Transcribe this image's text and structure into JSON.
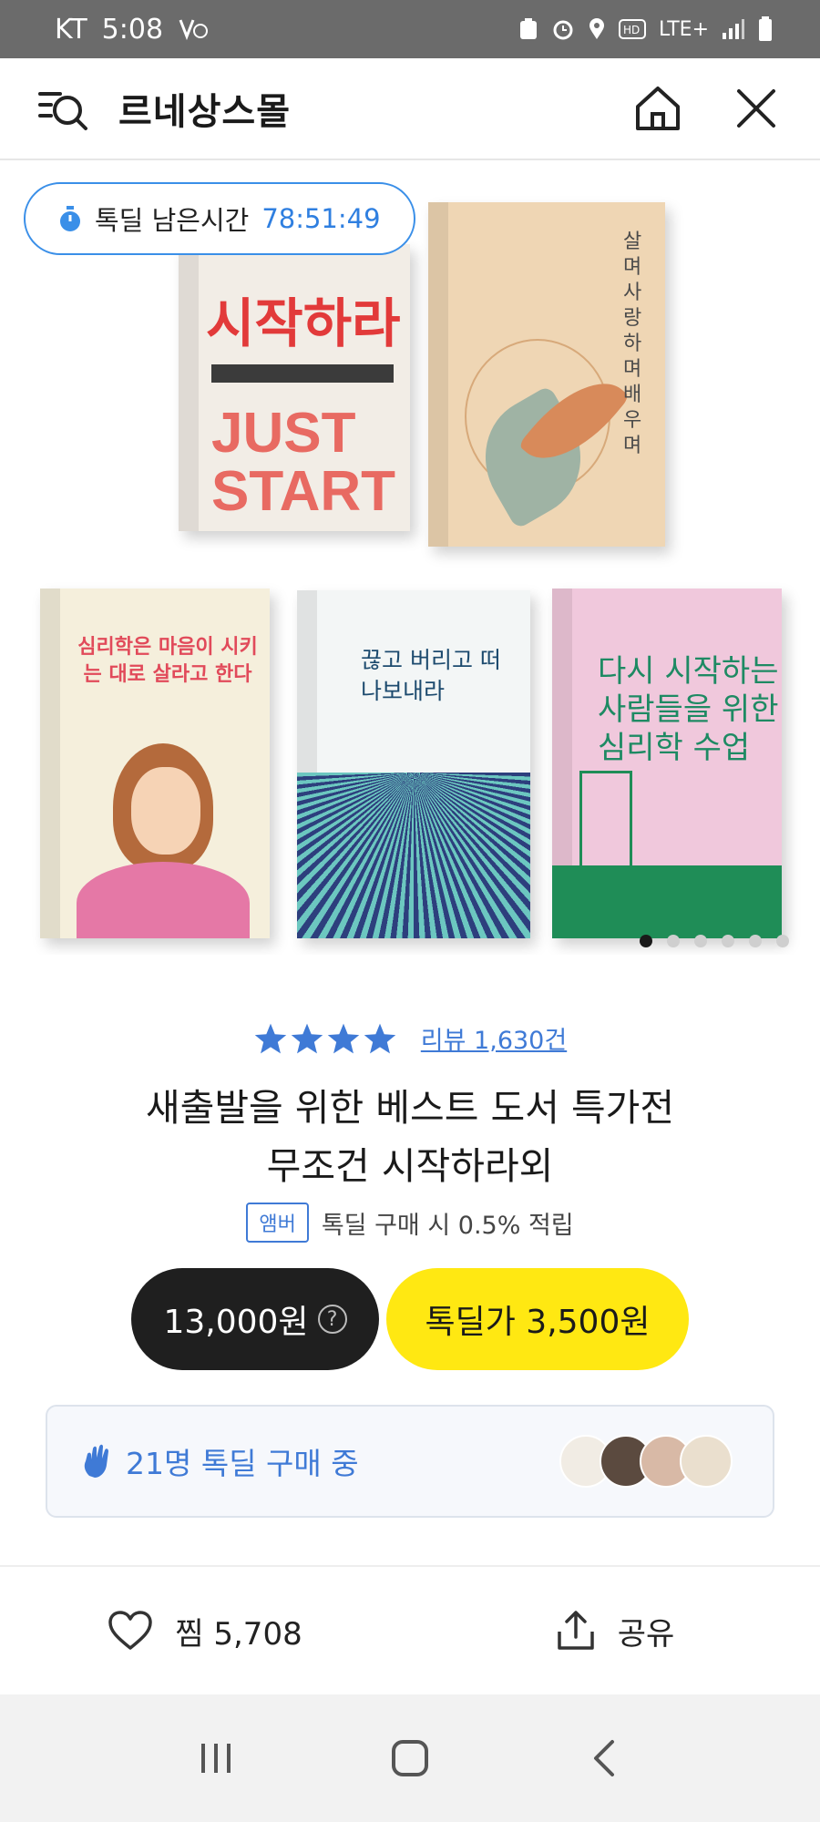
{
  "status_bar": {
    "carrier": "KT",
    "time": "5:08",
    "network": "LTE+"
  },
  "header": {
    "title": "르네상스몰"
  },
  "carousel": {
    "timer_label": "톡딜 남은시간",
    "timer_value": "78:51:49",
    "slide_count": 6,
    "active_slide": 1,
    "books": [
      {
        "cover_text": "시작하라"
      },
      {
        "cover_text": "살며 사랑하며 배우며"
      },
      {
        "cover_text": "심리학은 마음이 시키는 대로 살라고 한다"
      },
      {
        "cover_text": "끊고 버리고 떠나보내라"
      },
      {
        "cover_text": "다시 시작하는 사람들을 위한 심리학 수업"
      }
    ],
    "b1_extra": "JUST START"
  },
  "product": {
    "rating_stars": 4,
    "review_link": "리뷰 1,630건",
    "title_line1": "새출발을 위한 베스트 도서 특가전",
    "title_line2": "무조건 시작하라외",
    "member_badge": "앰버",
    "member_text": "톡딜 구매 시 0.5% 적립",
    "original_price": "13,000원",
    "help_icon": "?",
    "deal_price": "톡딜가  3,500원"
  },
  "buyers": {
    "text": "21명 톡딜 구매 중",
    "avatar_colors": [
      "#f1ece4",
      "#5b4a3f",
      "#d8b9a6",
      "#eadfce"
    ]
  },
  "actions": {
    "like_label": "찜 5,708",
    "share_label": "공유"
  },
  "colors": {
    "accent_blue": "#3f7ad6",
    "deal_yellow": "#ffe812",
    "dark": "#1f1f1f"
  }
}
